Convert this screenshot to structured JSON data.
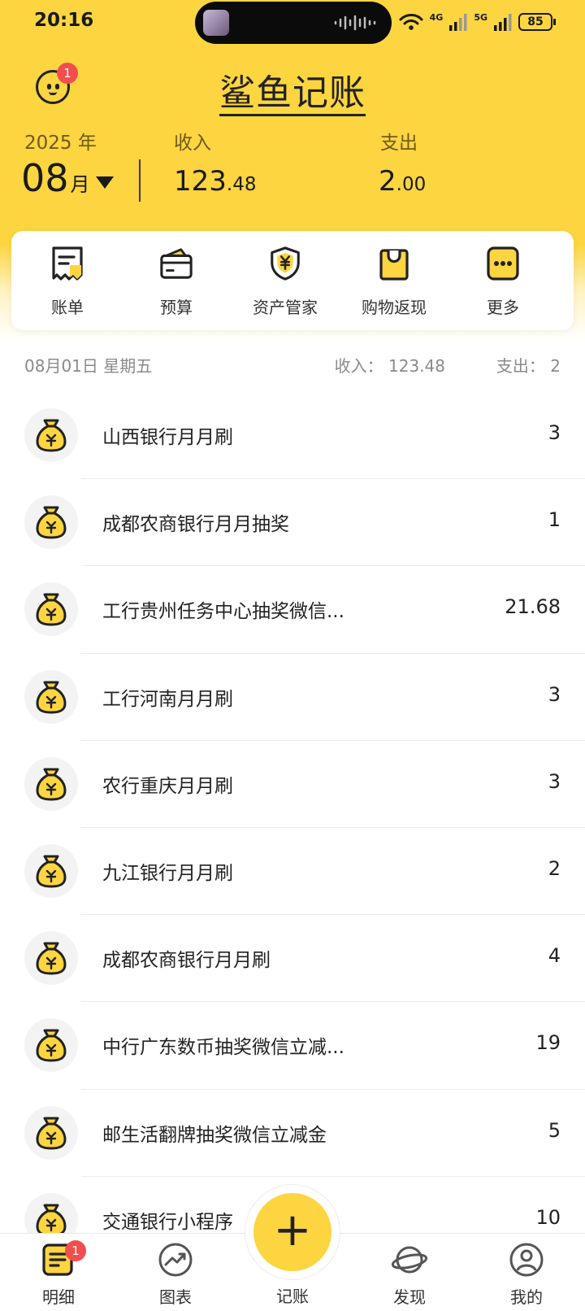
{
  "status_bar": {
    "time": "20:16",
    "net1": "4G",
    "net2": "5G",
    "battery": "85"
  },
  "header": {
    "app_title": "鲨鱼记账",
    "notification_count": "1",
    "year": "2025 年",
    "month": "08",
    "month_unit": "月",
    "income_label": "收入",
    "income_int": "123",
    "income_dec": ".48",
    "expense_label": "支出",
    "expense_int": "2",
    "expense_dec": ".00"
  },
  "shortcuts": [
    {
      "label": "账单",
      "icon": "bill-icon"
    },
    {
      "label": "预算",
      "icon": "budget-wallet-icon"
    },
    {
      "label": "资产管家",
      "icon": "yuan-shield-icon"
    },
    {
      "label": "购物返现",
      "icon": "shopping-bag-icon"
    },
    {
      "label": "更多",
      "icon": "more-dots-icon"
    }
  ],
  "day_summary": {
    "date": "08月01日 星期五",
    "income": "收入： 123.48",
    "expense": "支出： 2"
  },
  "transactions": [
    {
      "name": "山西银行月月刷",
      "amount": "3"
    },
    {
      "name": "成都农商银行月月抽奖",
      "amount": "1"
    },
    {
      "name": "工行贵州任务中心抽奖微信...",
      "amount": "21.68"
    },
    {
      "name": "工行河南月月刷",
      "amount": "3"
    },
    {
      "name": "农行重庆月月刷",
      "amount": "3"
    },
    {
      "name": "九江银行月月刷",
      "amount": "2"
    },
    {
      "name": "成都农商银行月月刷",
      "amount": "4"
    },
    {
      "name": "中行广东数币抽奖微信立减...",
      "amount": "19"
    },
    {
      "name": "邮生活翻牌抽奖微信立减金",
      "amount": "5"
    },
    {
      "name": "交通银行小程序",
      "amount": "10"
    }
  ],
  "bottom_nav": {
    "detail": "明细",
    "detail_badge": "1",
    "chart": "图表",
    "add": "记账",
    "add_symbol": "+",
    "discover": "发现",
    "mine": "我的"
  },
  "colors": {
    "accent": "#fcd540",
    "badge": "#f24e4e"
  }
}
